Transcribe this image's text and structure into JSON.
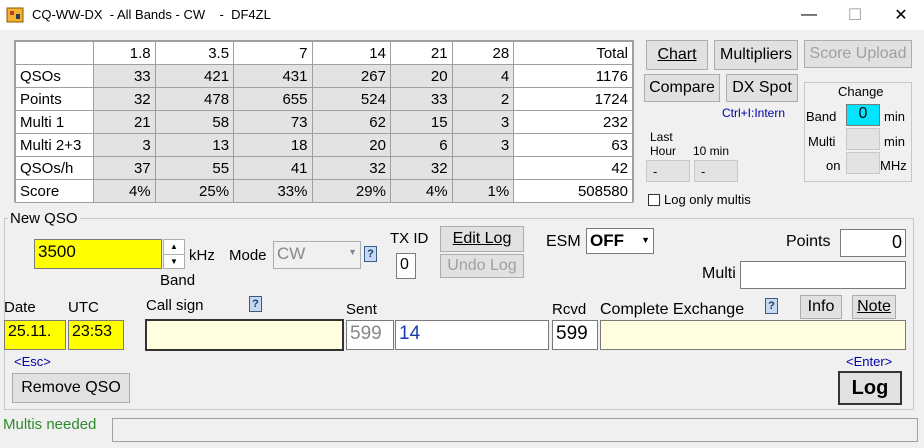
{
  "window": {
    "title": "CQ-WW-DX  - All Bands - CW    -  DF4ZL",
    "minimize": "—",
    "maximize": "☐",
    "close": "✕"
  },
  "score_table": {
    "columns": [
      "",
      "1.8",
      "3.5",
      "7",
      "14",
      "21",
      "28",
      "Total"
    ],
    "rows": [
      {
        "label": "QSOs",
        "values": [
          "33",
          "421",
          "431",
          "267",
          "20",
          "4",
          "1176"
        ]
      },
      {
        "label": "Points",
        "values": [
          "32",
          "478",
          "655",
          "524",
          "33",
          "2",
          "1724"
        ]
      },
      {
        "label": "Multi 1",
        "values": [
          "21",
          "58",
          "73",
          "62",
          "15",
          "3",
          "232"
        ]
      },
      {
        "label": "Multi 2+3",
        "values": [
          "3",
          "13",
          "18",
          "20",
          "6",
          "3",
          "63"
        ]
      },
      {
        "label": "QSOs/h",
        "values": [
          "37",
          "55",
          "41",
          "32",
          "32",
          "",
          "42"
        ]
      },
      {
        "label": "Score",
        "values": [
          "4%",
          "25%",
          "33%",
          "29%",
          "4%",
          "1%",
          "508580"
        ]
      }
    ]
  },
  "right_panel": {
    "chart": "Chart",
    "multipliers": "Multipliers",
    "score_upload": "Score Upload",
    "compare": "Compare",
    "dx_spot": "DX Spot",
    "ctrl_hint": "Ctrl+I:Intern",
    "last_hour": "Last\nHour",
    "ten_min": "10 min",
    "last_hour_value": "-",
    "ten_min_value": "-",
    "log_only_multis": "Log only multis",
    "change": {
      "title": "Change",
      "band_label": "Band",
      "band_value": "0",
      "band_unit": "min",
      "multi_label": "Multi",
      "multi_unit": "min",
      "on_label": "on",
      "on_unit": "MHz"
    }
  },
  "new_qso": {
    "legend": "New QSO",
    "frequency": "3500",
    "khz": "kHz",
    "band": "Band",
    "mode_label": "Mode",
    "mode_value": "CW",
    "tx_id_label": "TX ID",
    "tx_id_value": "0",
    "edit_log": "Edit Log",
    "undo_log": "Undo Log",
    "esm_label": "ESM",
    "esm_value": "OFF",
    "points_label": "Points",
    "points_value": "0",
    "multi_label": "Multi",
    "multi_value": "",
    "date_label": "Date",
    "date_value": "25.11.",
    "utc_label": "UTC",
    "utc_value": "23:53",
    "callsign_label": "Call sign",
    "callsign_value": "",
    "sent_label": "Sent",
    "sent_rst": "599",
    "sent_zone": "14",
    "rcvd_label": "Rcvd",
    "rcvd_value": "599",
    "exchange_label": "Complete Exchange",
    "exchange_value": "",
    "info": "Info",
    "note": "Note",
    "help": "?",
    "esc_hint": "<Esc>",
    "enter_hint": "<Enter>",
    "remove_qso": "Remove QSO",
    "log": "Log"
  },
  "status": {
    "text": "Multis needed",
    "color": "#2e8b2e"
  }
}
